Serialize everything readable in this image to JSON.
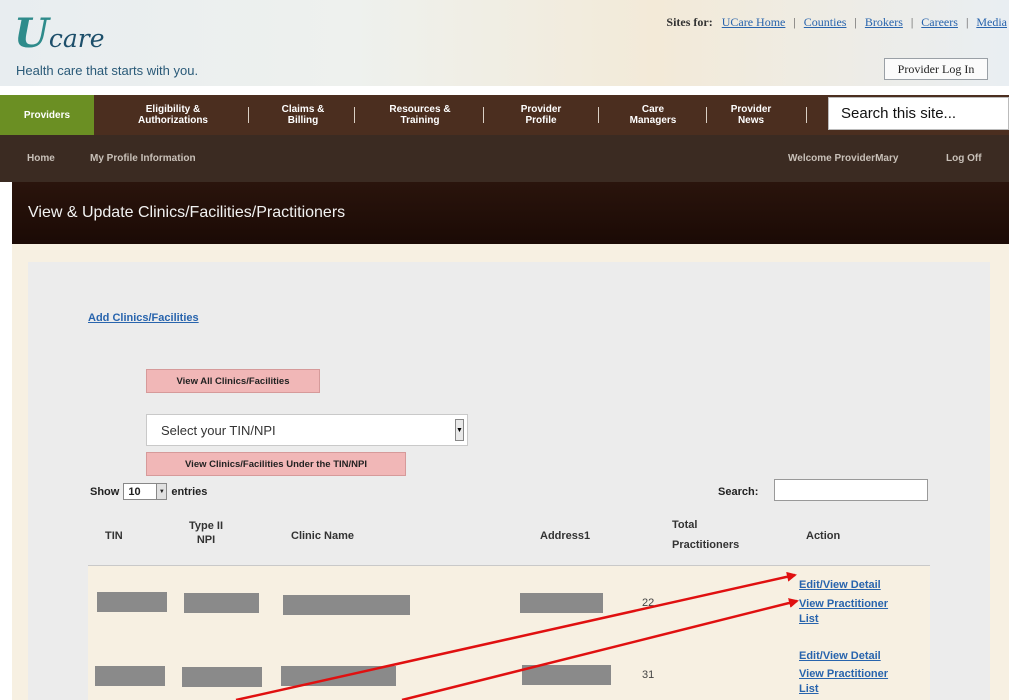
{
  "header": {
    "logo_mark": "U",
    "logo_rest": "care",
    "tagline": "Health care that starts with you.",
    "sites_label": "Sites for:",
    "sites_links": [
      "UCare Home",
      "Counties",
      "Brokers",
      "Careers",
      "Media"
    ],
    "login_label": "Provider Log In"
  },
  "nav": {
    "active": "Providers",
    "items": [
      {
        "line1": "Eligibility &",
        "line2": "Authorizations"
      },
      {
        "line1": "Claims &",
        "line2": "Billing"
      },
      {
        "line1": "Resources &",
        "line2": "Training"
      },
      {
        "line1": "Provider",
        "line2": "Profile"
      },
      {
        "line1": "Care",
        "line2": "Managers"
      },
      {
        "line1": "Provider",
        "line2": "News"
      }
    ],
    "search_placeholder": "Search this site..."
  },
  "subnav": {
    "home": "Home",
    "profile": "My Profile Information",
    "welcome": "Welcome ProviderMary",
    "logoff": "Log Off"
  },
  "page": {
    "title": "View & Update Clinics/Facilities/Practitioners",
    "add_link": "Add Clinics/Facilities",
    "view_all_button": "View All Clinics/Facilities",
    "select_placeholder": "Select your TIN/NPI",
    "view_under_button": "View Clinics/Facilities Under the TIN/NPI",
    "show_label": "Show",
    "entries_value": "10",
    "entries_label": "entries",
    "search_label": "Search:"
  },
  "table": {
    "headers": {
      "tin": "TIN",
      "npi_line1": "Type II",
      "npi_line2": "NPI",
      "clinic": "Clinic Name",
      "address": "Address1",
      "total_line1": "Total",
      "total_line2": "Practitioners",
      "action": "Action"
    },
    "rows": [
      {
        "total": "22",
        "edit": "Edit/View Detail",
        "view_line1": "View Practitioner",
        "view_line2": "List"
      },
      {
        "total": "31",
        "edit": "Edit/View Detail",
        "view_line1": "View Practitioner",
        "view_line2": "List"
      }
    ]
  },
  "colors": {
    "brand_brown": "#4b2e1f",
    "active_green": "#6b8f23",
    "link_blue": "#2864ad",
    "button_pink": "#f1b7b7",
    "annotation_red": "#e01010"
  }
}
